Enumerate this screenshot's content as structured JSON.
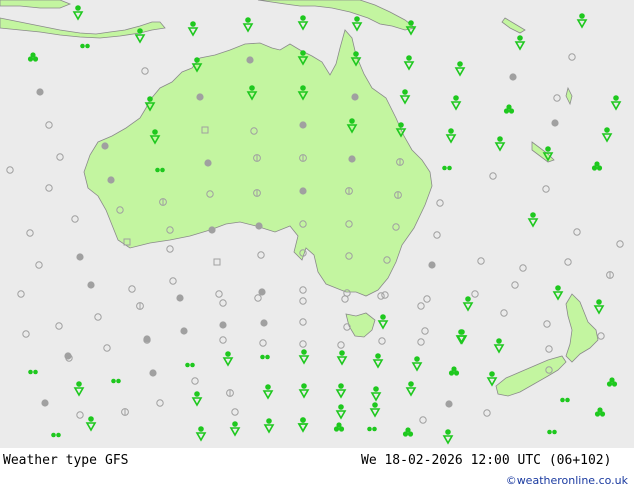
{
  "colors": {
    "sea": "#ebebeb",
    "land": "#c3f5a0",
    "coast": "#8a8a8a",
    "precip": "#1ec81e",
    "dry": "#a0a0a0"
  },
  "footer": {
    "label": "Weather type",
    "model": "GFS",
    "datetime": "We 18-02-2026 12:00 UTC (06+102)",
    "credit": "©weatheronline.co.uk"
  },
  "symbol_legend": {
    "rain": "green drop (precipitation)",
    "showers": "green clover (showers)",
    "drizzle": "green double dot (drizzle)",
    "cloud": "grey filled dot (overcast)",
    "partly": "grey open circle (partly cloudy)",
    "fog": "grey striped dot (fog/haze)"
  },
  "symbols": [
    [
      "rain",
      78,
      12
    ],
    [
      "rain",
      140,
      35
    ],
    [
      "rain",
      193,
      28
    ],
    [
      "rain",
      248,
      24
    ],
    [
      "rain",
      303,
      22
    ],
    [
      "rain",
      357,
      23
    ],
    [
      "rain",
      411,
      27
    ],
    [
      "rain",
      520,
      42
    ],
    [
      "rain",
      582,
      20
    ],
    [
      "showers",
      33,
      58
    ],
    [
      "drizzle",
      85,
      46
    ],
    [
      "partly",
      145,
      71
    ],
    [
      "rain",
      197,
      64
    ],
    [
      "cloud",
      250,
      60
    ],
    [
      "rain",
      303,
      57
    ],
    [
      "rain",
      356,
      58
    ],
    [
      "rain",
      409,
      62
    ],
    [
      "rain",
      460,
      68
    ],
    [
      "cloud",
      513,
      77
    ],
    [
      "partly",
      572,
      57
    ],
    [
      "cloud",
      40,
      92
    ],
    [
      "rain",
      150,
      103
    ],
    [
      "cloud",
      200,
      97
    ],
    [
      "rain",
      252,
      92
    ],
    [
      "rain",
      303,
      92
    ],
    [
      "cloud",
      355,
      97
    ],
    [
      "rain",
      405,
      96
    ],
    [
      "rain",
      456,
      102
    ],
    [
      "showers",
      509,
      110
    ],
    [
      "partly",
      557,
      98
    ],
    [
      "rain",
      616,
      102
    ],
    [
      "partly",
      49,
      125
    ],
    [
      "rain",
      155,
      136
    ],
    [
      "square",
      205,
      130
    ],
    [
      "partly",
      254,
      131
    ],
    [
      "cloud",
      303,
      125
    ],
    [
      "rain",
      352,
      125
    ],
    [
      "rain",
      401,
      129
    ],
    [
      "rain",
      451,
      135
    ],
    [
      "rain",
      500,
      143
    ],
    [
      "cloud",
      555,
      123
    ],
    [
      "rain",
      607,
      134
    ],
    [
      "partly",
      60,
      157
    ],
    [
      "cloud",
      105,
      146
    ],
    [
      "drizzle",
      160,
      170
    ],
    [
      "cloud",
      208,
      163
    ],
    [
      "fog",
      257,
      158
    ],
    [
      "fog",
      303,
      158
    ],
    [
      "cloud",
      352,
      159
    ],
    [
      "fog",
      400,
      162
    ],
    [
      "drizzle",
      447,
      168
    ],
    [
      "rain",
      548,
      153
    ],
    [
      "showers",
      597,
      167
    ],
    [
      "partly",
      10,
      170
    ],
    [
      "partly",
      49,
      188
    ],
    [
      "cloud",
      111,
      180
    ],
    [
      "fog",
      163,
      202
    ],
    [
      "partly",
      210,
      194
    ],
    [
      "fog",
      257,
      193
    ],
    [
      "cloud",
      303,
      191
    ],
    [
      "fog",
      349,
      191
    ],
    [
      "fog",
      398,
      195
    ],
    [
      "partly",
      440,
      203
    ],
    [
      "partly",
      493,
      176
    ],
    [
      "partly",
      546,
      189
    ],
    [
      "partly",
      30,
      233
    ],
    [
      "partly",
      75,
      219
    ],
    [
      "partly",
      120,
      210
    ],
    [
      "partly",
      170,
      230
    ],
    [
      "cloud",
      212,
      230
    ],
    [
      "cloud",
      259,
      226
    ],
    [
      "partly",
      303,
      224
    ],
    [
      "partly",
      349,
      224
    ],
    [
      "partly",
      396,
      227
    ],
    [
      "partly",
      437,
      235
    ],
    [
      "rain",
      533,
      219
    ],
    [
      "partly",
      577,
      232
    ],
    [
      "partly",
      39,
      265
    ],
    [
      "cloud",
      80,
      257
    ],
    [
      "square",
      127,
      242
    ],
    [
      "partly",
      170,
      249
    ],
    [
      "square",
      217,
      262
    ],
    [
      "partly",
      261,
      255
    ],
    [
      "partly",
      303,
      253
    ],
    [
      "partly",
      349,
      256
    ],
    [
      "partly",
      387,
      260
    ],
    [
      "cloud",
      432,
      265
    ],
    [
      "partly",
      481,
      261
    ],
    [
      "partly",
      523,
      268
    ],
    [
      "partly",
      568,
      262
    ],
    [
      "partly",
      620,
      244
    ],
    [
      "partly",
      21,
      294
    ],
    [
      "cloud",
      91,
      285
    ],
    [
      "partly",
      132,
      289
    ],
    [
      "partly",
      173,
      281
    ],
    [
      "partly",
      219,
      294
    ],
    [
      "cloud",
      262,
      292
    ],
    [
      "partly",
      303,
      290
    ],
    [
      "partly",
      347,
      293
    ],
    [
      "partly",
      385,
      295
    ],
    [
      "partly",
      427,
      299
    ],
    [
      "partly",
      475,
      294
    ],
    [
      "partly",
      515,
      285
    ],
    [
      "rain",
      558,
      292
    ],
    [
      "fog",
      610,
      275
    ],
    [
      "partly",
      59,
      326
    ],
    [
      "partly",
      98,
      317
    ],
    [
      "fog",
      140,
      306
    ],
    [
      "cloud",
      180,
      298
    ],
    [
      "partly",
      223,
      303
    ],
    [
      "partly",
      258,
      298
    ],
    [
      "partly",
      303,
      301
    ],
    [
      "partly",
      345,
      299
    ],
    [
      "partly",
      381,
      296
    ],
    [
      "partly",
      421,
      306
    ],
    [
      "rain",
      468,
      303
    ],
    [
      "partly",
      504,
      313
    ],
    [
      "rain",
      599,
      306
    ],
    [
      "partly",
      26,
      334
    ],
    [
      "cloud",
      147,
      339
    ],
    [
      "cloud",
      184,
      331
    ],
    [
      "cloud",
      223,
      325
    ],
    [
      "cloud",
      264,
      323
    ],
    [
      "partly",
      303,
      322
    ],
    [
      "partly",
      347,
      327
    ],
    [
      "rain",
      383,
      321
    ],
    [
      "partly",
      425,
      331
    ],
    [
      "rain",
      462,
      336
    ],
    [
      "partly",
      547,
      324
    ],
    [
      "partly",
      69,
      358
    ],
    [
      "partly",
      107,
      348
    ],
    [
      "partly",
      147,
      340
    ],
    [
      "cloud",
      68,
      356
    ],
    [
      "partly",
      223,
      340
    ],
    [
      "partly",
      263,
      343
    ],
    [
      "partly",
      303,
      344
    ],
    [
      "partly",
      341,
      345
    ],
    [
      "partly",
      382,
      341
    ],
    [
      "partly",
      421,
      342
    ],
    [
      "rain",
      461,
      336
    ],
    [
      "rain",
      499,
      345
    ],
    [
      "partly",
      549,
      349
    ],
    [
      "partly",
      601,
      336
    ],
    [
      "drizzle",
      33,
      372
    ],
    [
      "cloud",
      153,
      373
    ],
    [
      "drizzle",
      190,
      365
    ],
    [
      "rain",
      228,
      358
    ],
    [
      "drizzle",
      265,
      357
    ],
    [
      "rain",
      304,
      356
    ],
    [
      "rain",
      342,
      357
    ],
    [
      "rain",
      378,
      360
    ],
    [
      "rain",
      417,
      363
    ],
    [
      "showers",
      454,
      372
    ],
    [
      "rain",
      492,
      378
    ],
    [
      "partly",
      549,
      370
    ],
    [
      "rain",
      79,
      388
    ],
    [
      "drizzle",
      116,
      381
    ],
    [
      "partly",
      195,
      381
    ],
    [
      "fog",
      230,
      393
    ],
    [
      "rain",
      268,
      391
    ],
    [
      "rain",
      304,
      390
    ],
    [
      "rain",
      341,
      390
    ],
    [
      "rain",
      376,
      393
    ],
    [
      "rain",
      411,
      388
    ],
    [
      "cloud",
      449,
      404
    ],
    [
      "partly",
      487,
      413
    ],
    [
      "drizzle",
      565,
      400
    ],
    [
      "showers",
      612,
      383
    ],
    [
      "cloud",
      45,
      403
    ],
    [
      "partly",
      80,
      415
    ],
    [
      "fog",
      125,
      412
    ],
    [
      "partly",
      160,
      403
    ],
    [
      "rain",
      197,
      398
    ],
    [
      "partly",
      235,
      412
    ],
    [
      "rain",
      269,
      425
    ],
    [
      "rain",
      303,
      424
    ],
    [
      "rain",
      341,
      411
    ],
    [
      "rain",
      375,
      409
    ],
    [
      "partly",
      423,
      420
    ],
    [
      "showers",
      600,
      413
    ],
    [
      "drizzle",
      56,
      435
    ],
    [
      "rain",
      91,
      423
    ],
    [
      "rain",
      201,
      433
    ],
    [
      "rain",
      235,
      428
    ],
    [
      "rain",
      303,
      424
    ],
    [
      "showers",
      339,
      428
    ],
    [
      "drizzle",
      372,
      429
    ],
    [
      "showers",
      408,
      433
    ],
    [
      "rain",
      448,
      436
    ],
    [
      "drizzle",
      552,
      432
    ]
  ]
}
